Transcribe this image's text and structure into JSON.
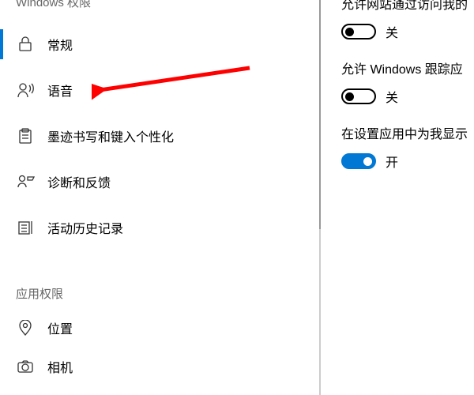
{
  "sidebar": {
    "header1": "Windows 权限",
    "items": [
      {
        "label": "常规",
        "iconName": "lock-icon",
        "selected": true
      },
      {
        "label": "语音",
        "iconName": "speech-icon",
        "selected": false
      },
      {
        "label": "墨迹书写和键入个性化",
        "iconName": "clipboard-icon",
        "selected": false
      },
      {
        "label": "诊断和反馈",
        "iconName": "feedback-icon",
        "selected": false
      },
      {
        "label": "活动历史记录",
        "iconName": "history-icon",
        "selected": false
      }
    ],
    "header2": "应用权限",
    "items2": [
      {
        "label": "位置",
        "iconName": "location-icon",
        "selected": false
      },
      {
        "label": "相机",
        "iconName": "camera-icon",
        "selected": false
      }
    ]
  },
  "main": {
    "options": [
      {
        "text": "允许网站通过访问我的",
        "state": "off",
        "stateLabel": "关"
      },
      {
        "text": "允许 Windows 跟踪应",
        "state": "off",
        "stateLabel": "关"
      },
      {
        "text": "在设置应用中为我显示",
        "state": "on",
        "stateLabel": "开"
      }
    ]
  },
  "annotation": {
    "arrowTarget": "语音"
  }
}
